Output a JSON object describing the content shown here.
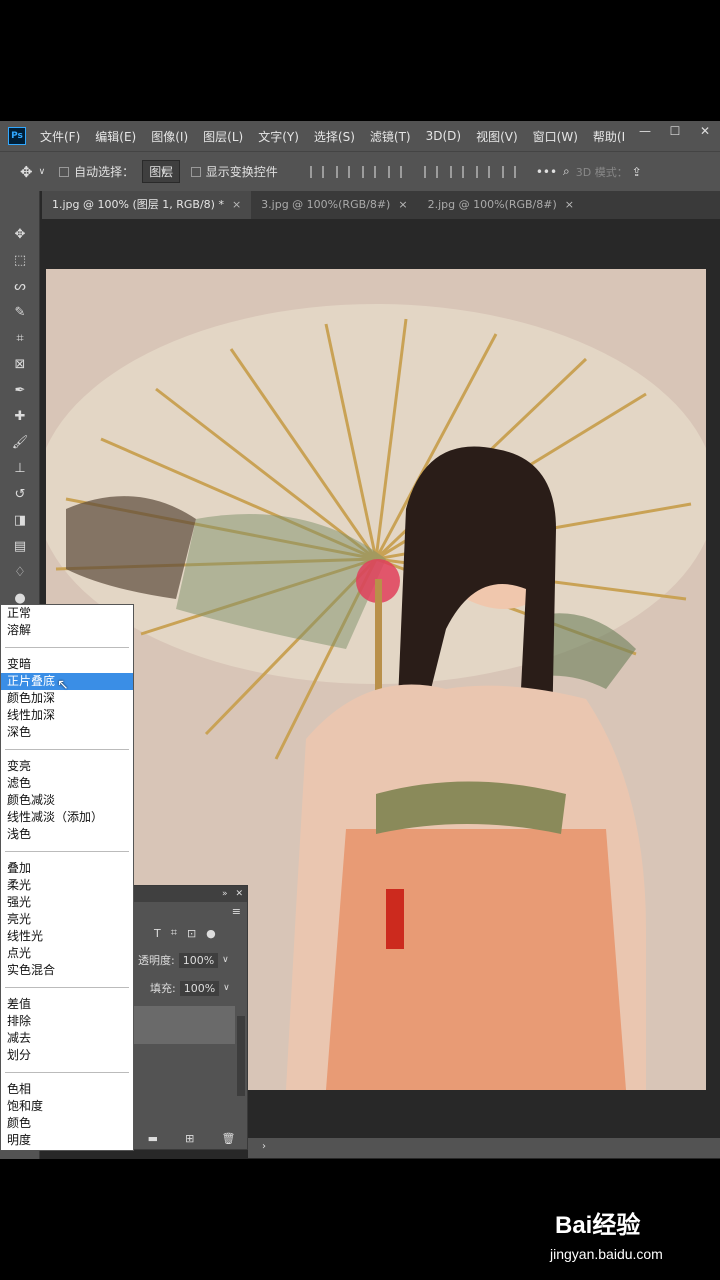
{
  "menubar": {
    "items": [
      "文件(F)",
      "编辑(E)",
      "图像(I)",
      "图层(L)",
      "文字(Y)",
      "选择(S)",
      "滤镜(T)",
      "3D(D)",
      "视图(V)",
      "窗口(W)",
      "帮助(I"
    ],
    "logo": "Ps"
  },
  "options": {
    "auto_select_label": "自动选择：",
    "auto_select_value": "图层",
    "transform_label": "显示变换控件",
    "mode_3d": "3D 模式："
  },
  "tabs": [
    {
      "label": "1.jpg @ 100% (图层 1, RGB/8) *",
      "close": "×"
    },
    {
      "label": "3.jpg @ 100%(RGB/8#)",
      "close": "×"
    },
    {
      "label": "2.jpg @ 100%(RGB/8#)",
      "close": "×"
    }
  ],
  "layers": {
    "opacity_label": "透明度:",
    "opacity_value": "100%",
    "fill_label": "填充:",
    "fill_value": "100%"
  },
  "blend_menu": {
    "groups": [
      [
        "正常",
        "溶解"
      ],
      [
        "变暗",
        "正片叠底",
        "颜色加深",
        "线性加深",
        "深色"
      ],
      [
        "变亮",
        "滤色",
        "颜色减淡",
        "线性减淡（添加）",
        "浅色"
      ],
      [
        "叠加",
        "柔光",
        "强光",
        "亮光",
        "线性光",
        "点光",
        "实色混合"
      ],
      [
        "差值",
        "排除",
        "减去",
        "划分"
      ],
      [
        "色相",
        "饱和度",
        "颜色",
        "明度"
      ]
    ],
    "selected": "正片叠底"
  },
  "watermark": {
    "brand": "Bai经验",
    "url": "jingyan.baidu.com"
  },
  "colors": {
    "accent": "#3a8ee6",
    "panel": "#535353",
    "bg": "#282828"
  }
}
